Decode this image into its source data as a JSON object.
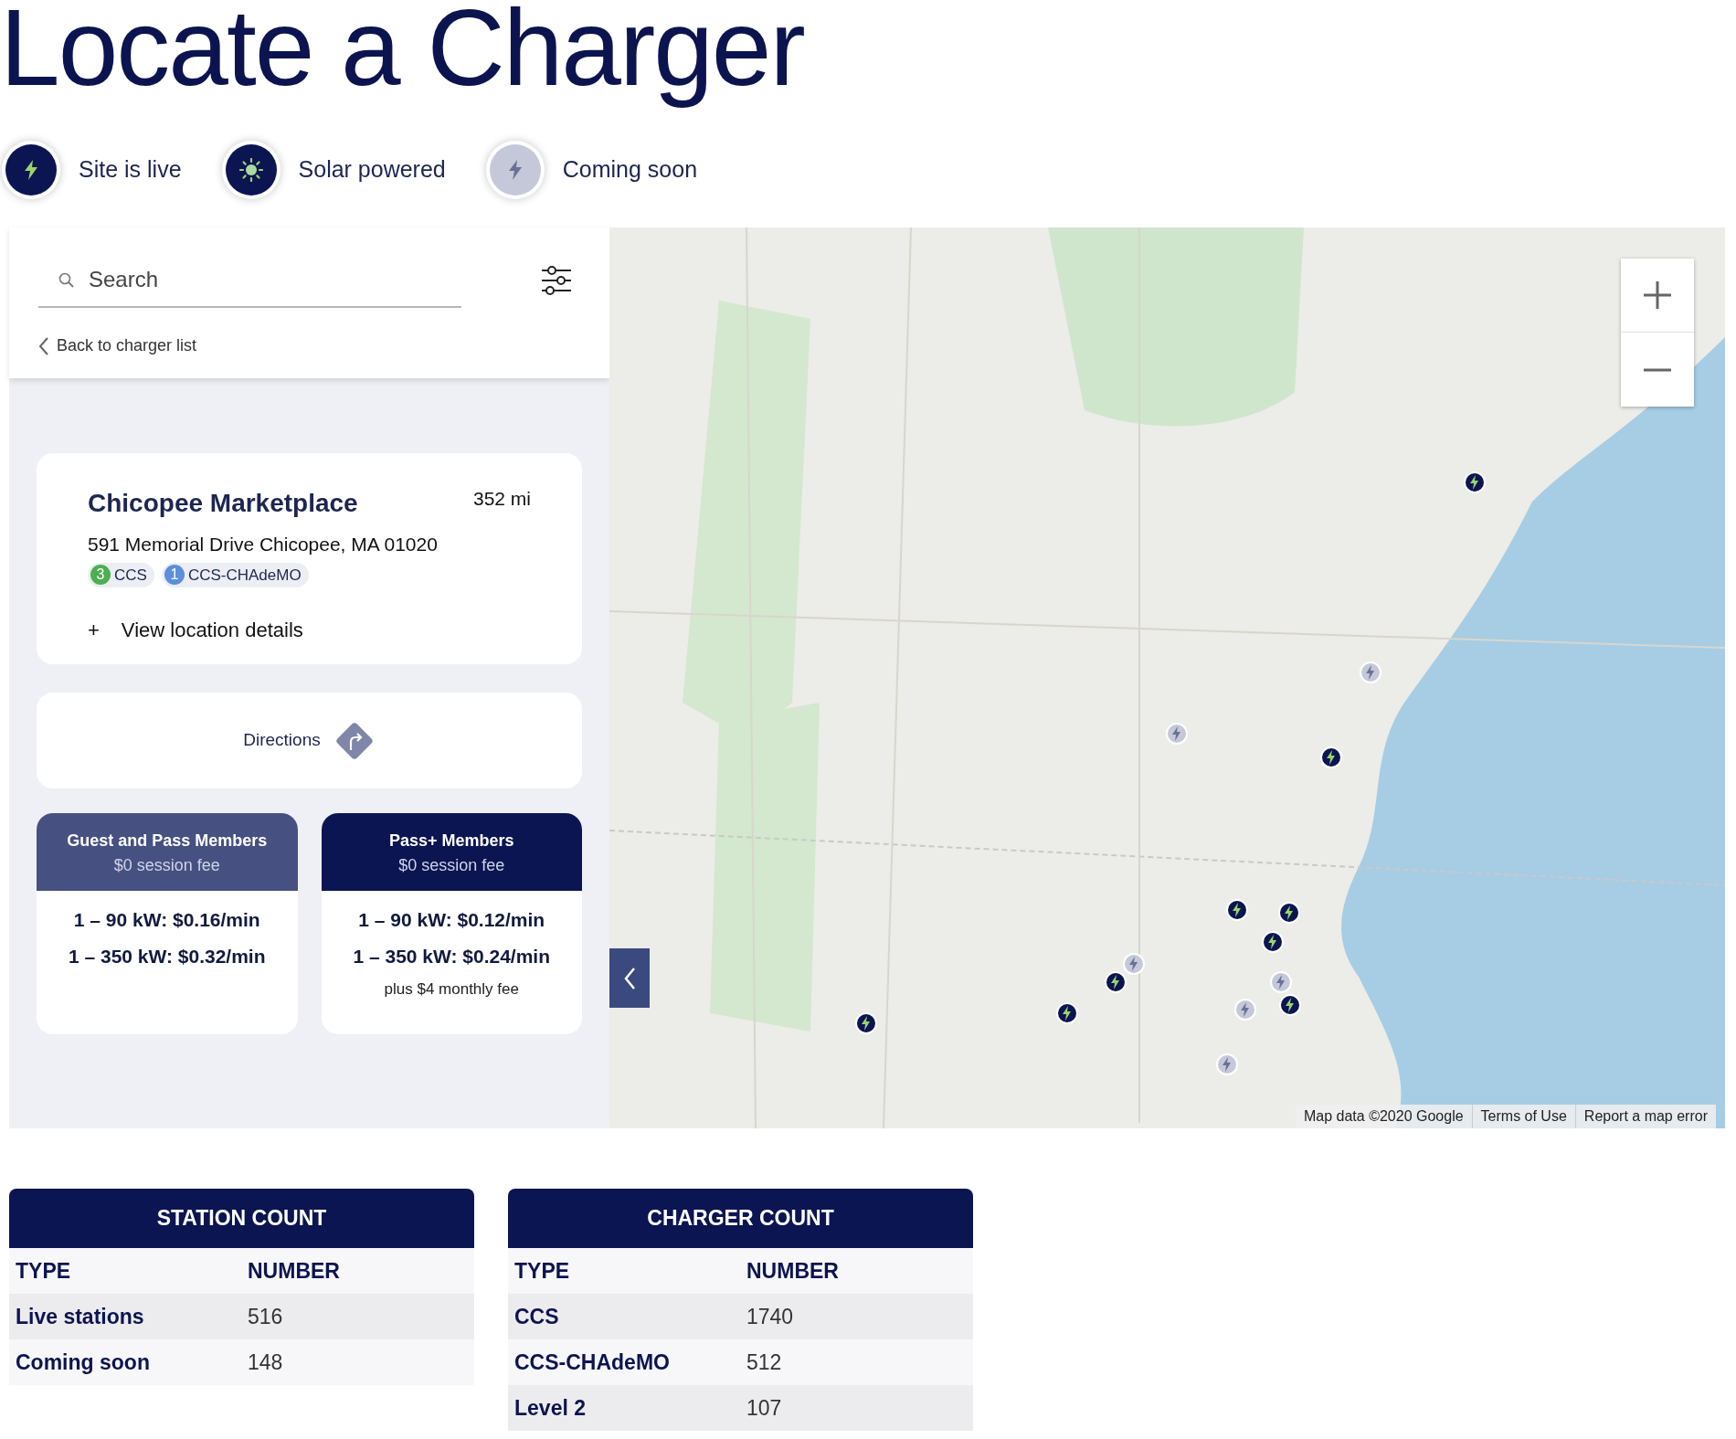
{
  "title": "Locate a Charger",
  "legend": [
    {
      "kind": "live",
      "label": "Site is live"
    },
    {
      "kind": "solar",
      "label": "Solar powered"
    },
    {
      "kind": "soon",
      "label": "Coming soon"
    }
  ],
  "sidebar": {
    "search": {
      "placeholder": "Search"
    },
    "back_link": "Back to charger list",
    "location": {
      "name": "Chicopee Marketplace",
      "distance": "352 mi",
      "address": "591 Memorial Drive Chicopee, MA 01020",
      "connectors": [
        {
          "count": "3",
          "label": "CCS",
          "color": "#4caf50"
        },
        {
          "count": "1",
          "label": "CCS-CHAdeMO",
          "color": "#5b8fd9"
        }
      ],
      "details_toggle": "+",
      "details_link": "View location details"
    },
    "directions": "Directions",
    "pricing": [
      {
        "title": "Guest and Pass Members",
        "subtitle": "$0 session fee",
        "color": "#465181",
        "rates": [
          "1 – 90 kW: $0.16/min",
          "1 – 350 kW: $0.32/min"
        ]
      },
      {
        "title": "Pass+ Members",
        "subtitle": "$0 session fee",
        "color": "#0b1552",
        "rates": [
          "1 – 90 kW: $0.12/min",
          "1 – 350 kW: $0.24/min"
        ],
        "note": "plus $4 monthly fee"
      }
    ]
  },
  "map": {
    "pins": [
      {
        "kind": "live"
      },
      {
        "kind": "live"
      },
      {
        "kind": "live"
      },
      {
        "kind": "live"
      },
      {
        "kind": "live"
      },
      {
        "kind": "live"
      },
      {
        "kind": "live"
      },
      {
        "kind": "live"
      },
      {
        "kind": "live"
      },
      {
        "kind": "soon"
      },
      {
        "kind": "soon"
      },
      {
        "kind": "soon"
      },
      {
        "kind": "soon"
      },
      {
        "kind": "soon"
      },
      {
        "kind": "soon"
      }
    ],
    "attribution": [
      "Map data ©2020 Google",
      "Terms of Use",
      "Report a map error"
    ]
  },
  "tables": [
    {
      "title": "STATION COUNT",
      "columns": [
        "TYPE",
        "NUMBER"
      ],
      "rows": [
        [
          "Live stations",
          "516"
        ],
        [
          "Coming soon",
          "148"
        ]
      ]
    },
    {
      "title": "CHARGER COUNT",
      "columns": [
        "TYPE",
        "NUMBER"
      ],
      "rows": [
        [
          "CCS",
          "1740"
        ],
        [
          "CCS-CHAdeMO",
          "512"
        ],
        [
          "Level 2",
          "107"
        ]
      ]
    }
  ]
}
